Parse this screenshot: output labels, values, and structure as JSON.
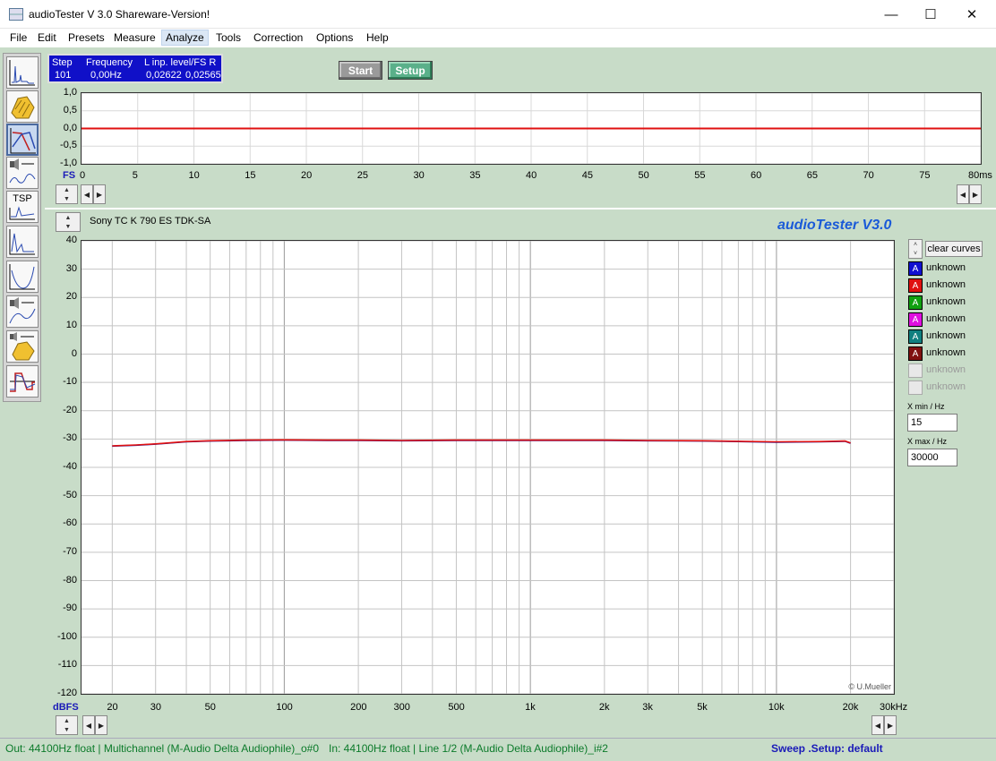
{
  "window": {
    "title": "audioTester  V 3.0 Shareware-Version!",
    "minimize": "—",
    "maximize": "☐",
    "close": "✕"
  },
  "menu": [
    "File",
    "Edit",
    "Presets",
    "Measure",
    "Analyze",
    "Tools",
    "Correction",
    "Options",
    "Help"
  ],
  "menu_active": "Analyze",
  "readout": {
    "step_label": "Step",
    "freq_label": "Frequency",
    "level_label": "L  inp. level/FS  R",
    "step": "101",
    "freq": "0,00Hz",
    "level_l": "0,02622",
    "level_r": "0,02565"
  },
  "buttons": {
    "start": "Start",
    "setup": "Setup",
    "clear_curves": "clear curves"
  },
  "time_plot": {
    "y_ticks": [
      "1,0",
      "0,5",
      "0,0",
      "-0,5",
      "-1,0"
    ],
    "x_ticks": [
      "0",
      "5",
      "10",
      "15",
      "20",
      "25",
      "30",
      "35",
      "40",
      "45",
      "50",
      "55",
      "60",
      "65",
      "70",
      "75",
      "80ms"
    ],
    "y_unit": "FS"
  },
  "freq_plot": {
    "device": "Sony TC K 790 ES TDK-SA",
    "brand": "audioTester  V3.0",
    "copyright": "© U.Mueller",
    "y_unit": "dBFS"
  },
  "legend": [
    {
      "label": "unknown",
      "color": "#1010d0",
      "enabled": true
    },
    {
      "label": "unknown",
      "color": "#e01010",
      "enabled": true
    },
    {
      "label": "unknown",
      "color": "#10a010",
      "enabled": true
    },
    {
      "label": "unknown",
      "color": "#e010e0",
      "enabled": true
    },
    {
      "label": "unknown",
      "color": "#108080",
      "enabled": true
    },
    {
      "label": "unknown",
      "color": "#801010",
      "enabled": true
    },
    {
      "label": "unknown",
      "color": "#e8e8e8",
      "enabled": false
    },
    {
      "label": "unknown",
      "color": "#e8e8e8",
      "enabled": false
    }
  ],
  "legend_glyph": "A",
  "xmin": {
    "label": "X min / Hz",
    "value": "15"
  },
  "xmax": {
    "label": "X max / Hz",
    "value": "30000"
  },
  "status": {
    "out": "Out: 44100Hz float  | Multichannel (M-Audio Delta Audiophile)_o#0",
    "in": "In: 44100Hz float  | Line 1/2 (M-Audio Delta Audiophile)_i#2",
    "sweep": "Sweep  .Setup:  default"
  },
  "chart_data": [
    {
      "type": "line",
      "title": "",
      "xlabel": "",
      "ylabel": "FS",
      "x_unit": "ms",
      "xlim": [
        0,
        80
      ],
      "ylim": [
        -1.0,
        1.0
      ],
      "x_ticks": [
        0,
        5,
        10,
        15,
        20,
        25,
        30,
        35,
        40,
        45,
        50,
        55,
        60,
        65,
        70,
        75,
        80
      ],
      "y_ticks": [
        1.0,
        0.5,
        0.0,
        -0.5,
        -1.0
      ],
      "grid": true,
      "series": [
        {
          "color": "#e01010",
          "x": [
            0,
            80
          ],
          "y": [
            0.0,
            0.0
          ]
        }
      ]
    },
    {
      "type": "line",
      "title": "",
      "xlabel": "",
      "ylabel": "dBFS",
      "x_scale": "log",
      "x_unit": "Hz",
      "xlim": [
        15,
        30000
      ],
      "ylim": [
        -120,
        40
      ],
      "y_ticks": [
        40,
        30,
        20,
        10,
        0,
        -10,
        -20,
        -30,
        -40,
        -50,
        -60,
        -70,
        -80,
        -90,
        -100,
        -110,
        -120
      ],
      "x_ticks": [
        {
          "value": 20,
          "label": "20"
        },
        {
          "value": 30,
          "label": "30"
        },
        {
          "value": 50,
          "label": "50"
        },
        {
          "value": 100,
          "label": "100"
        },
        {
          "value": 200,
          "label": "200"
        },
        {
          "value": 300,
          "label": "300"
        },
        {
          "value": 500,
          "label": "500"
        },
        {
          "value": 1000,
          "label": "1k"
        },
        {
          "value": 2000,
          "label": "2k"
        },
        {
          "value": 3000,
          "label": "3k"
        },
        {
          "value": 5000,
          "label": "5k"
        },
        {
          "value": 10000,
          "label": "10k"
        },
        {
          "value": 20000,
          "label": "20k"
        },
        {
          "value": 30000,
          "label": "30kHz"
        }
      ],
      "grid": true,
      "series": [
        {
          "color": "#1a1aa0",
          "x": [
            20,
            25,
            30,
            40,
            50,
            70,
            100,
            150,
            200,
            300,
            500,
            700,
            1000,
            2000,
            3000,
            5000,
            7000,
            10000,
            15000,
            19000,
            20000
          ],
          "y": [
            -32.5,
            -32.2,
            -31.8,
            -31.0,
            -30.7,
            -30.5,
            -30.4,
            -30.5,
            -30.5,
            -30.6,
            -30.5,
            -30.5,
            -30.5,
            -30.5,
            -30.6,
            -30.7,
            -30.9,
            -31.1,
            -31.0,
            -30.8,
            -31.5
          ]
        },
        {
          "color": "#e01010",
          "x": [
            20,
            25,
            30,
            40,
            50,
            70,
            100,
            150,
            200,
            300,
            500,
            700,
            1000,
            2000,
            3000,
            5000,
            7000,
            10000,
            15000,
            19000,
            20000
          ],
          "y": [
            -32.4,
            -32.1,
            -31.7,
            -30.9,
            -30.6,
            -30.4,
            -30.3,
            -30.4,
            -30.4,
            -30.5,
            -30.4,
            -30.4,
            -30.4,
            -30.4,
            -30.5,
            -30.6,
            -30.8,
            -31.0,
            -30.9,
            -30.7,
            -31.4
          ]
        }
      ]
    }
  ]
}
